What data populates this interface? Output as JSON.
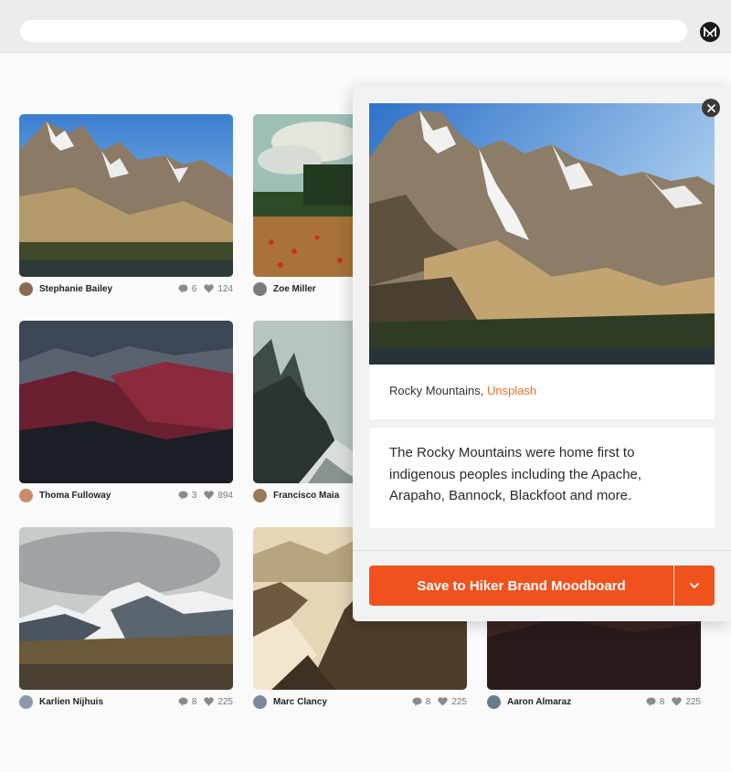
{
  "search": {
    "value": "",
    "placeholder": ""
  },
  "header": {
    "brand_icon": "m-logo-icon"
  },
  "cards": [
    {
      "author": "Stephanie Bailey",
      "comments": "6",
      "likes": "124"
    },
    {
      "author": "Zoe Miller"
    },
    {
      "author": "Thoma Fulloway",
      "comments": "3",
      "likes": "894"
    },
    {
      "author": "Francisco Maia"
    },
    {
      "author": "Karlien Nijhuis",
      "comments": "8",
      "likes": "225"
    },
    {
      "author": "Marc Clancy",
      "comments": "8",
      "likes": "225"
    },
    {
      "author": "Aaron Almaraz",
      "comments": "8",
      "likes": "225"
    }
  ],
  "detail": {
    "caption_title": "Rocky Mountains,",
    "caption_source": "Unsplash",
    "description": "The Rocky Mountains were home first to indigenous peoples including the Apache, Arapaho, Bannock, Blackfoot and more.",
    "save_label": "Save to Hiker Brand Moodboard"
  },
  "colors": {
    "accent": "#f0521d",
    "link": "#e8712a"
  }
}
